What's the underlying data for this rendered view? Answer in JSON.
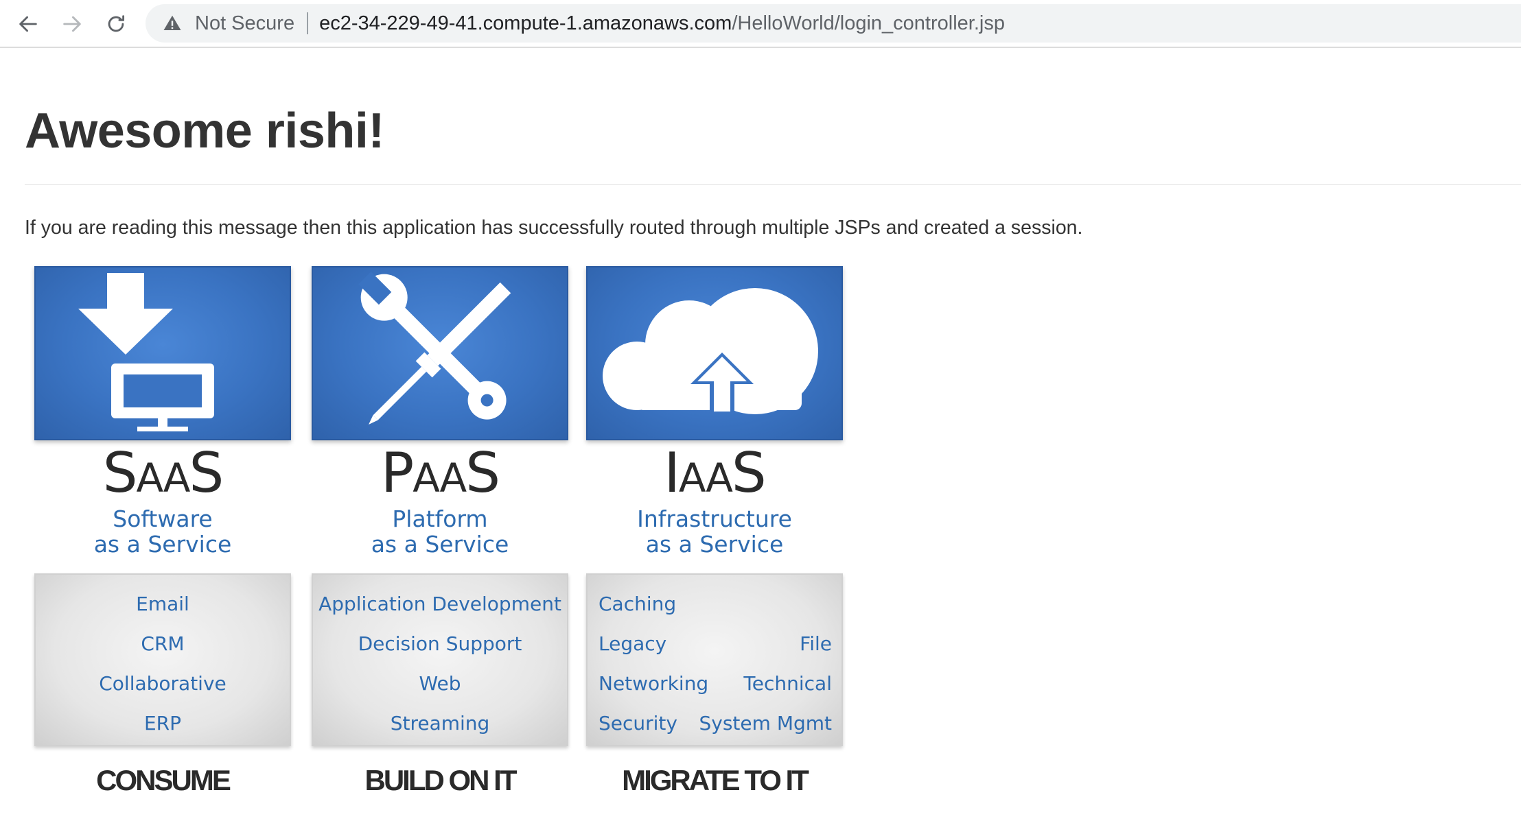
{
  "browser": {
    "security_label": "Not Secure",
    "url_host": "ec2-34-229-49-41.compute-1.amazonaws.com",
    "url_path": "/HelloWorld/login_controller.jsp"
  },
  "page": {
    "title": "Awesome rishi!",
    "lead": "If you are reading this message then this application has successfully routed through multiple JSPs and created a session."
  },
  "services": [
    {
      "abbr_first": "S",
      "abbr_middle": "AA",
      "abbr_last": "S",
      "name_line1": "Software",
      "name_line2": "as a Service",
      "icon": "download-monitor-icon",
      "items": [
        "Email",
        "CRM",
        "Collaborative",
        "ERP"
      ],
      "action": "CONSUME"
    },
    {
      "abbr_first": "P",
      "abbr_middle": "AA",
      "abbr_last": "S",
      "name_line1": "Platform",
      "name_line2": "as a Service",
      "icon": "wrench-screwdriver-icon",
      "items": [
        "Application Development",
        "Decision Support",
        "Web",
        "Streaming"
      ],
      "action": "BUILD ON IT"
    },
    {
      "abbr_first": "I",
      "abbr_middle": "AA",
      "abbr_last": "S",
      "name_line1": "Infrastructure",
      "name_line2": "as a Service",
      "icon": "cloud-upload-icon",
      "grid": [
        [
          "Caching",
          ""
        ],
        [
          "Legacy",
          "File"
        ],
        [
          "Networking",
          "Technical"
        ],
        [
          "Security",
          "System Mgmt"
        ]
      ],
      "action": "MIGRATE TO IT"
    }
  ],
  "colors": {
    "tile_blue": "#3a73c2",
    "text_blue": "#2d6bb0",
    "heading": "#333333"
  }
}
